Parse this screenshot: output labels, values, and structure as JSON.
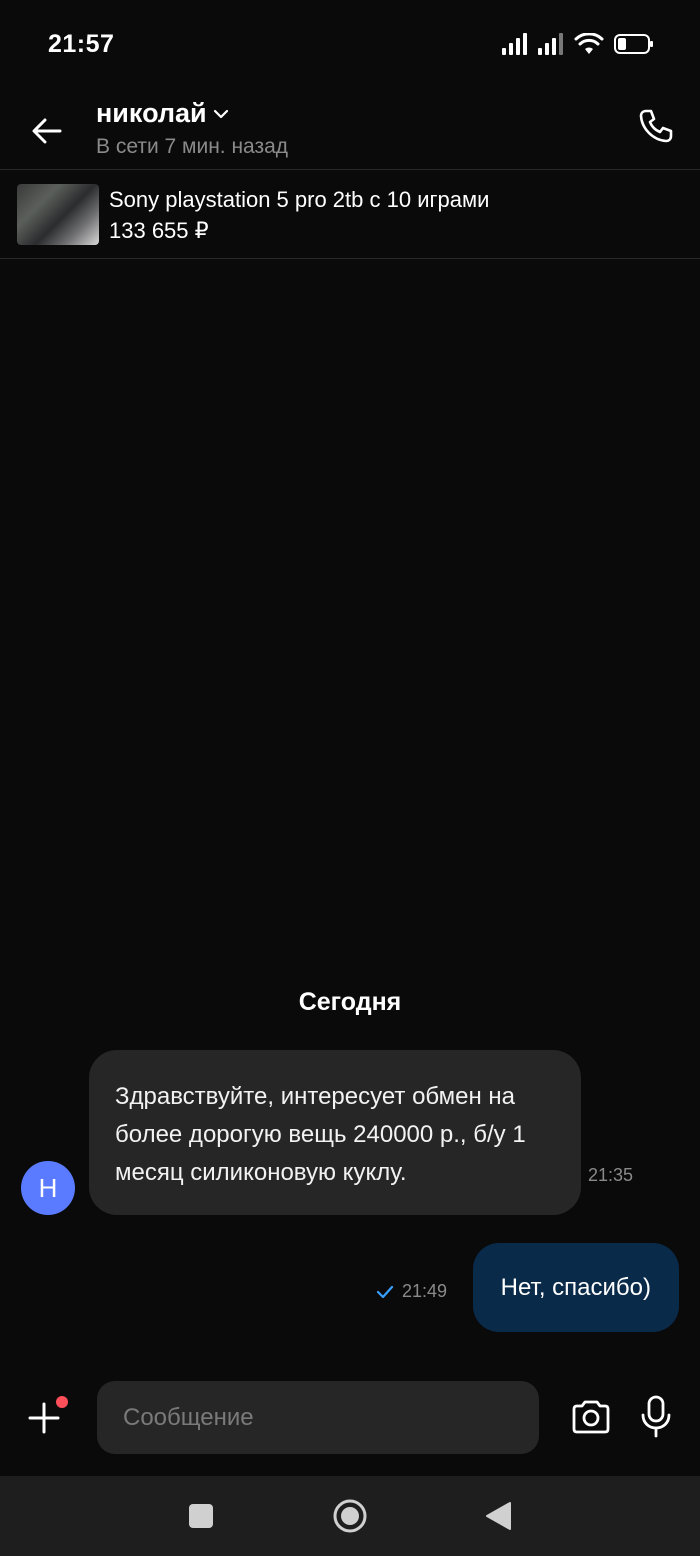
{
  "status_bar": {
    "time": "21:57",
    "icons": [
      "signal-icon",
      "signal-icon",
      "wifi-icon",
      "battery-icon"
    ]
  },
  "header": {
    "contact_name": "николай",
    "contact_status": "В сети 7 мин. назад",
    "icons": {
      "back": "arrow-left-icon",
      "dropdown": "chevron-down-icon",
      "call": "phone-icon"
    }
  },
  "product": {
    "title": "Sony playstation 5 pro 2tb с 10 играми",
    "price": "133 655 ₽"
  },
  "chat": {
    "date_divider": "Сегодня",
    "messages": [
      {
        "direction": "incoming",
        "avatar_letter": "Н",
        "text": "Здравствуйте, интересует обмен на более дорогую вещь 240000 р., б/у 1 месяц силиконовую куклу.",
        "time": "21:35"
      },
      {
        "direction": "outgoing",
        "text": "Нет, спасибо)",
        "time": "21:49",
        "status_icon": "check-icon"
      }
    ]
  },
  "composer": {
    "placeholder": "Сообщение",
    "icons": {
      "attach": "plus-icon",
      "camera": "camera-icon",
      "mic": "microphone-icon"
    }
  },
  "colors": {
    "background": "#0a0a0a",
    "incoming_bubble": "#262626",
    "outgoing_bubble": "#0a2a4a",
    "avatar": "#5a7bff",
    "notification_dot": "#ff4f5a",
    "read_check": "#3aa0ff"
  }
}
